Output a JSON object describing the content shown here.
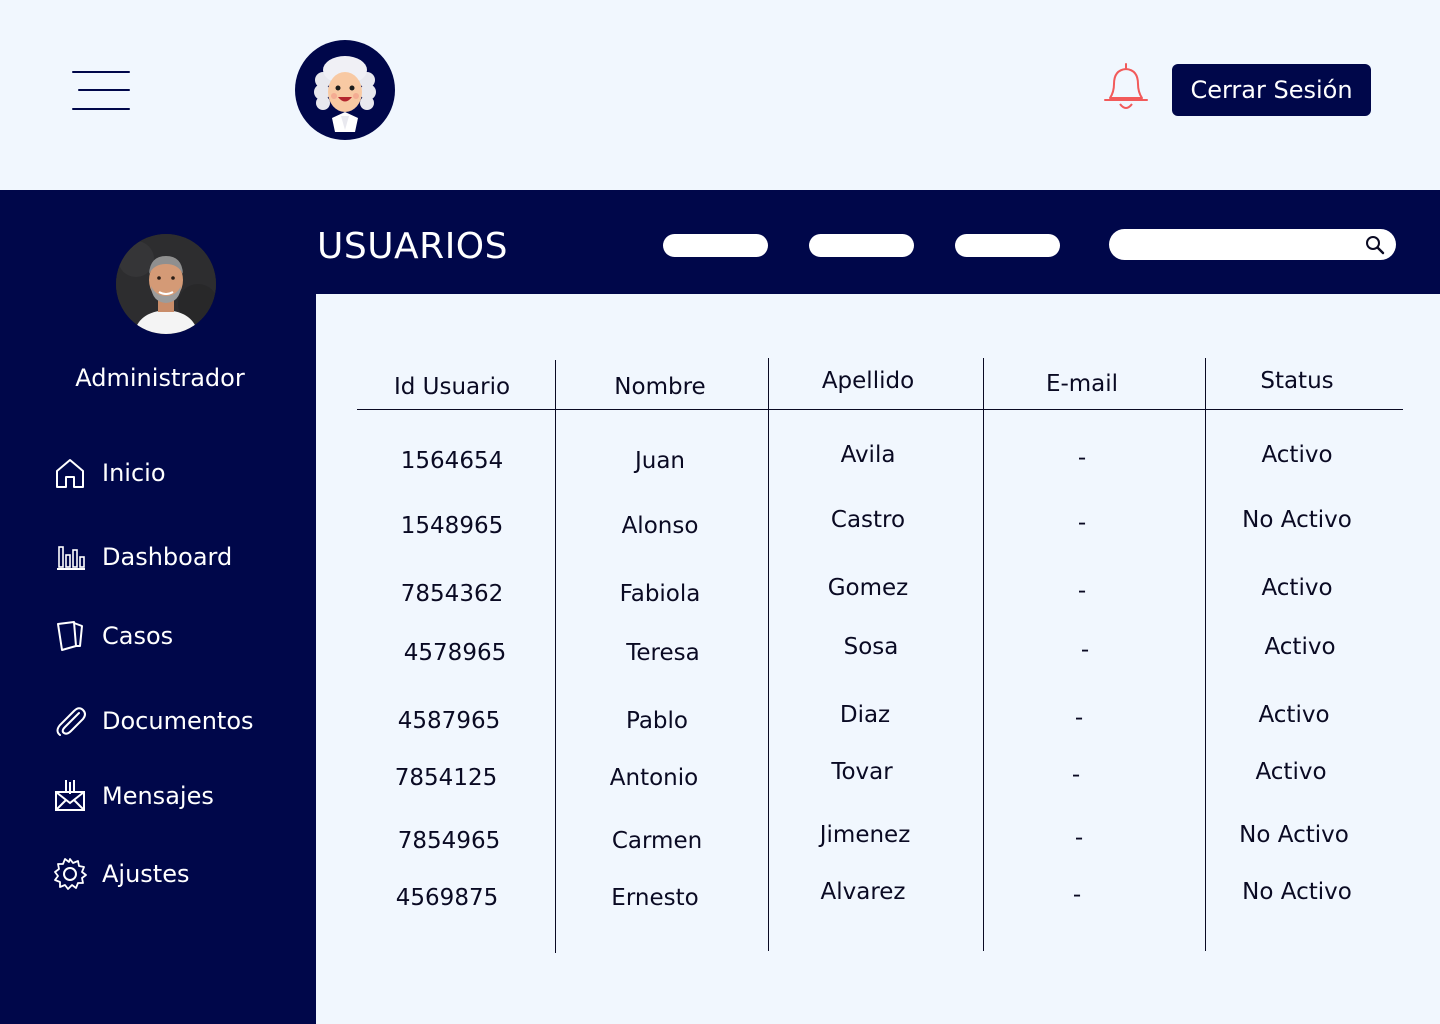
{
  "header": {
    "logout_label": "Cerrar Sesión"
  },
  "sidebar": {
    "role": "Administrador",
    "items": [
      {
        "label": "Inicio",
        "icon": "home-icon"
      },
      {
        "label": "Dashboard",
        "icon": "bar-chart-icon"
      },
      {
        "label": "Casos",
        "icon": "folder-icon"
      },
      {
        "label": "Documentos",
        "icon": "paperclip-icon"
      },
      {
        "label": "Mensajes",
        "icon": "mail-icon"
      },
      {
        "label": "Ajustes",
        "icon": "gear-icon"
      }
    ]
  },
  "main": {
    "title": "USUARIOS",
    "search_value": ""
  },
  "table": {
    "columns": [
      "Id Usuario",
      "Nombre",
      "Apellido",
      "E-mail",
      "Status"
    ],
    "rows": [
      [
        "1564654",
        "Juan",
        "Avila",
        "-",
        "Activo"
      ],
      [
        "1548965",
        "Alonso",
        "Castro",
        "-",
        "No Activo"
      ],
      [
        "7854362",
        "Fabiola",
        "Gomez",
        "-",
        "Activo"
      ],
      [
        "4578965",
        "Teresa",
        "Sosa",
        "-",
        "Activo"
      ],
      [
        "4587965",
        "Pablo",
        "Diaz",
        "-",
        "Activo"
      ],
      [
        "7854125",
        "Antonio",
        "Tovar",
        "-",
        "Activo"
      ],
      [
        "7854965",
        "Carmen",
        "Jimenez",
        "-",
        "No Activo"
      ],
      [
        "4569875",
        "Ernesto",
        "Alvarez",
        "-",
        "No Activo"
      ]
    ]
  },
  "colors": {
    "navy": "#00074a",
    "background": "#f1f7fe",
    "bell": "#f25a5a"
  }
}
